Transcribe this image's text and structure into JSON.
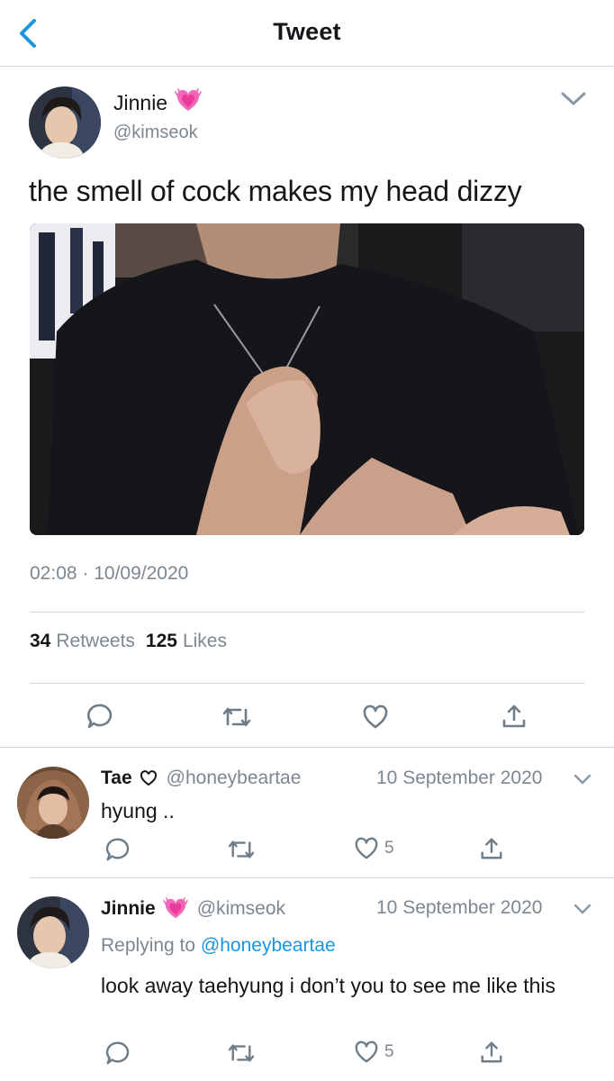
{
  "header": {
    "title": "Tweet",
    "back_icon": "chevron-left-icon",
    "accent": "#1b95e0"
  },
  "tweet": {
    "display_name": "Jinnie",
    "name_emoji": "growing-heart-icon",
    "handle": "@kimseok",
    "text": "the smell of cock makes my head dizzy",
    "time": "02:08",
    "date": "10/09/2020",
    "retweets_count": "34",
    "retweets_label": "Retweets",
    "likes_count": "125",
    "likes_label": "Likes",
    "actions": [
      "reply-icon",
      "retweet-icon",
      "like-icon",
      "share-icon"
    ]
  },
  "replies": [
    {
      "display_name": "Tae",
      "name_emoji": "heart-outline-icon",
      "handle": "@honeybeartae",
      "date": "10 September 2020",
      "text": "hyung ..",
      "like_count": "5"
    },
    {
      "display_name": "Jinnie",
      "name_emoji": "growing-heart-icon",
      "handle": "@kimseok",
      "date": "10 September 2020",
      "replying_label": "Replying to",
      "replying_to": "@honeybeartae",
      "text": "look away taehyung i don’t you to see me like this",
      "like_count": "5"
    }
  ]
}
